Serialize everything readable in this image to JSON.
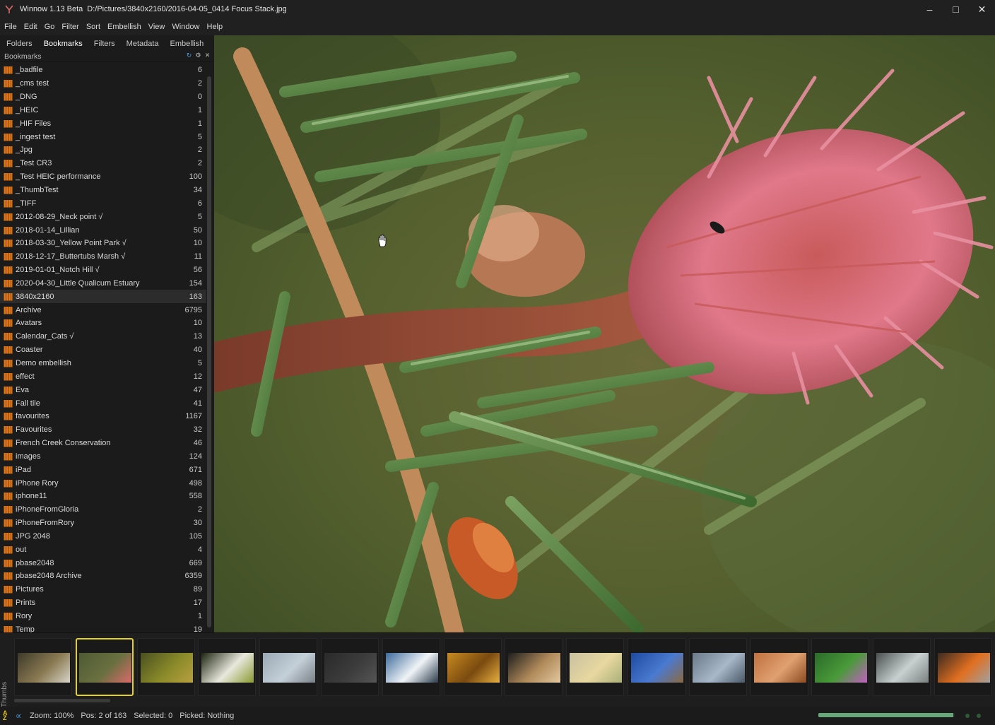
{
  "window": {
    "app_name": "Winnow 1.13 Beta",
    "file_path": "D:/Pictures/3840x2160/2016-04-05_0414 Focus Stack.jpg",
    "controls": [
      "minimize-icon",
      "maximize-icon",
      "close-icon"
    ]
  },
  "menu": [
    "File",
    "Edit",
    "Go",
    "Filter",
    "Sort",
    "Embellish",
    "View",
    "Window",
    "Help"
  ],
  "tabs": [
    "Folders",
    "Bookmarks",
    "Filters",
    "Metadata",
    "Embellish"
  ],
  "active_tab": "Bookmarks",
  "panel": {
    "title": "Bookmarks",
    "icons": [
      "refresh-icon",
      "settings-icon",
      "close-icon"
    ]
  },
  "bookmarks": [
    {
      "name": "_badfile",
      "count": "6"
    },
    {
      "name": "_cms test",
      "count": "2"
    },
    {
      "name": "_DNG",
      "count": "0"
    },
    {
      "name": "_HEIC",
      "count": "1"
    },
    {
      "name": "_HIF Files",
      "count": "1"
    },
    {
      "name": "_ingest test",
      "count": "5"
    },
    {
      "name": "_Jpg",
      "count": "2"
    },
    {
      "name": "_Test CR3",
      "count": "2"
    },
    {
      "name": "_Test HEIC performance",
      "count": "100"
    },
    {
      "name": "_ThumbTest",
      "count": "34"
    },
    {
      "name": "_TIFF",
      "count": "6"
    },
    {
      "name": "2012-08-29_Neck point √",
      "count": "5"
    },
    {
      "name": "2018-01-14_Lillian",
      "count": "50"
    },
    {
      "name": "2018-03-30_Yellow Point Park √",
      "count": "10"
    },
    {
      "name": "2018-12-17_Buttertubs Marsh √",
      "count": "11"
    },
    {
      "name": "2019-01-01_Notch Hill √",
      "count": "56"
    },
    {
      "name": "2020-04-30_Little Qualicum Estuary",
      "count": "154"
    },
    {
      "name": "3840x2160",
      "count": "163"
    },
    {
      "name": "Archive",
      "count": "6795"
    },
    {
      "name": "Avatars",
      "count": "10"
    },
    {
      "name": "Calendar_Cats √",
      "count": "13"
    },
    {
      "name": "Coaster",
      "count": "40"
    },
    {
      "name": "Demo embellish",
      "count": "5"
    },
    {
      "name": "effect",
      "count": "12"
    },
    {
      "name": "Eva",
      "count": "47"
    },
    {
      "name": "Fall tile",
      "count": "41"
    },
    {
      "name": "favourites",
      "count": "1167"
    },
    {
      "name": "Favourites",
      "count": "32"
    },
    {
      "name": "French Creek Conservation",
      "count": "46"
    },
    {
      "name": "images",
      "count": "124"
    },
    {
      "name": "iPad",
      "count": "671"
    },
    {
      "name": "iPhone Rory",
      "count": "498"
    },
    {
      "name": "iphone11",
      "count": "558"
    },
    {
      "name": "iPhoneFromGloria",
      "count": "2"
    },
    {
      "name": "iPhoneFromRory",
      "count": "30"
    },
    {
      "name": "JPG 2048",
      "count": "105"
    },
    {
      "name": "out",
      "count": "4"
    },
    {
      "name": "pbase2048",
      "count": "669"
    },
    {
      "name": "pbase2048 Archive",
      "count": "6359"
    },
    {
      "name": "Pictures",
      "count": "89"
    },
    {
      "name": "Prints",
      "count": "17"
    },
    {
      "name": "Rory",
      "count": "1"
    },
    {
      "name": "Temp",
      "count": "19"
    }
  ],
  "highlighted_bookmark": "3840x2160",
  "thumbs_label": "Thumbs",
  "thumbnails": [
    {
      "subject": "stream in forest",
      "colors": [
        "#3d3a2a",
        "#8a7a52",
        "#d8d4c8"
      ]
    },
    {
      "subject": "pink flower on green",
      "colors": [
        "#4e5a34",
        "#6a7040",
        "#d86a6a"
      ],
      "selected": true
    },
    {
      "subject": "mossy branches",
      "colors": [
        "#4a5020",
        "#8a8a2a",
        "#b8a040"
      ]
    },
    {
      "subject": "white flowers",
      "colors": [
        "#1c2410",
        "#e8e8dc",
        "#8a9a30"
      ]
    },
    {
      "subject": "frosted glass",
      "colors": [
        "#9aa8b4",
        "#c4d0d8",
        "#7a8088"
      ]
    },
    {
      "subject": "dark texture",
      "colors": [
        "#2a2a2a",
        "#3c3c3c",
        "#555555"
      ]
    },
    {
      "subject": "snowy mountain",
      "colors": [
        "#3c6a9a",
        "#f0f4f8",
        "#2a3a4a"
      ]
    },
    {
      "subject": "golden forest",
      "colors": [
        "#c88a20",
        "#7a4a10",
        "#e8b040"
      ]
    },
    {
      "subject": "sparrow",
      "colors": [
        "#1e1e1e",
        "#b08a5a",
        "#e4c8a0"
      ]
    },
    {
      "subject": "yellow flower",
      "colors": [
        "#c8c0a0",
        "#e8d8a0",
        "#a8b078"
      ]
    },
    {
      "subject": "blue sky rocks",
      "colors": [
        "#1c4aa0",
        "#4a7ad0",
        "#8a6a40"
      ]
    },
    {
      "subject": "ice crystals",
      "colors": [
        "#6a7888",
        "#a8b8c8",
        "#4a5868"
      ]
    },
    {
      "subject": "rusty metal",
      "colors": [
        "#c07040",
        "#e0a070",
        "#8a4a20"
      ]
    },
    {
      "subject": "purple flower",
      "colors": [
        "#2a6a2a",
        "#4a9a3a",
        "#c060c0"
      ]
    },
    {
      "subject": "waterfall",
      "colors": [
        "#4a5050",
        "#c8d0d0",
        "#7a8080"
      ]
    },
    {
      "subject": "sunset trees",
      "colors": [
        "#3a2a20",
        "#e07020",
        "#a0a0a0"
      ]
    }
  ],
  "status": {
    "sort_icon": "sort-az-icon",
    "link_icon": "link-icon",
    "zoom": "Zoom: 100%",
    "position": "Pos: 2 of 163",
    "selected": "Selected: 0",
    "picked": "Picked: Nothing",
    "progress_fraction": 0.99,
    "progress_color": "#66a878"
  },
  "colors": {
    "selection_border": "#e6d21a",
    "folder_icon": "#e07a10",
    "background": "#1b1b1b"
  }
}
